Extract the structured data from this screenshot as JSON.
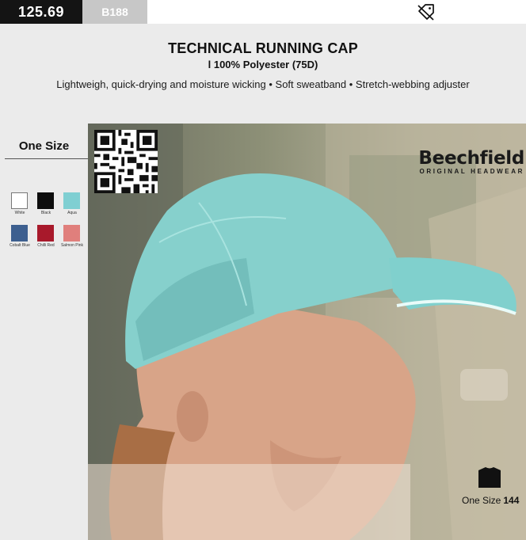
{
  "product": {
    "price": "125.69",
    "sku": "B188",
    "title": "TECHNICAL RUNNING CAP",
    "material": "l 100% Polyester (75D)",
    "description": "Lightweigh, quick-drying and moisture wicking • Soft sweatband • Stretch-webbing adjuster"
  },
  "sizes": {
    "label": "One Size"
  },
  "colors": [
    {
      "name": "White",
      "hex": "#ffffff"
    },
    {
      "name": "Black",
      "hex": "#0d0d0d"
    },
    {
      "name": "Aqua",
      "hex": "#7fcfd2"
    },
    {
      "name": "Cobalt Blue",
      "hex": "#3d5f8f"
    },
    {
      "name": "Chilli Red",
      "hex": "#a8192b"
    },
    {
      "name": "Salmon Pink",
      "hex": "#e07f7c"
    }
  ],
  "brand": {
    "name": "Beechfield",
    "tagline": "ORIGINAL HEADWEAR"
  },
  "stock": {
    "size": "One Size",
    "count": "144"
  },
  "icons": {
    "discount": "discount-tag-icon",
    "qr": "qr-code",
    "stock": "garment-stock-icon"
  }
}
